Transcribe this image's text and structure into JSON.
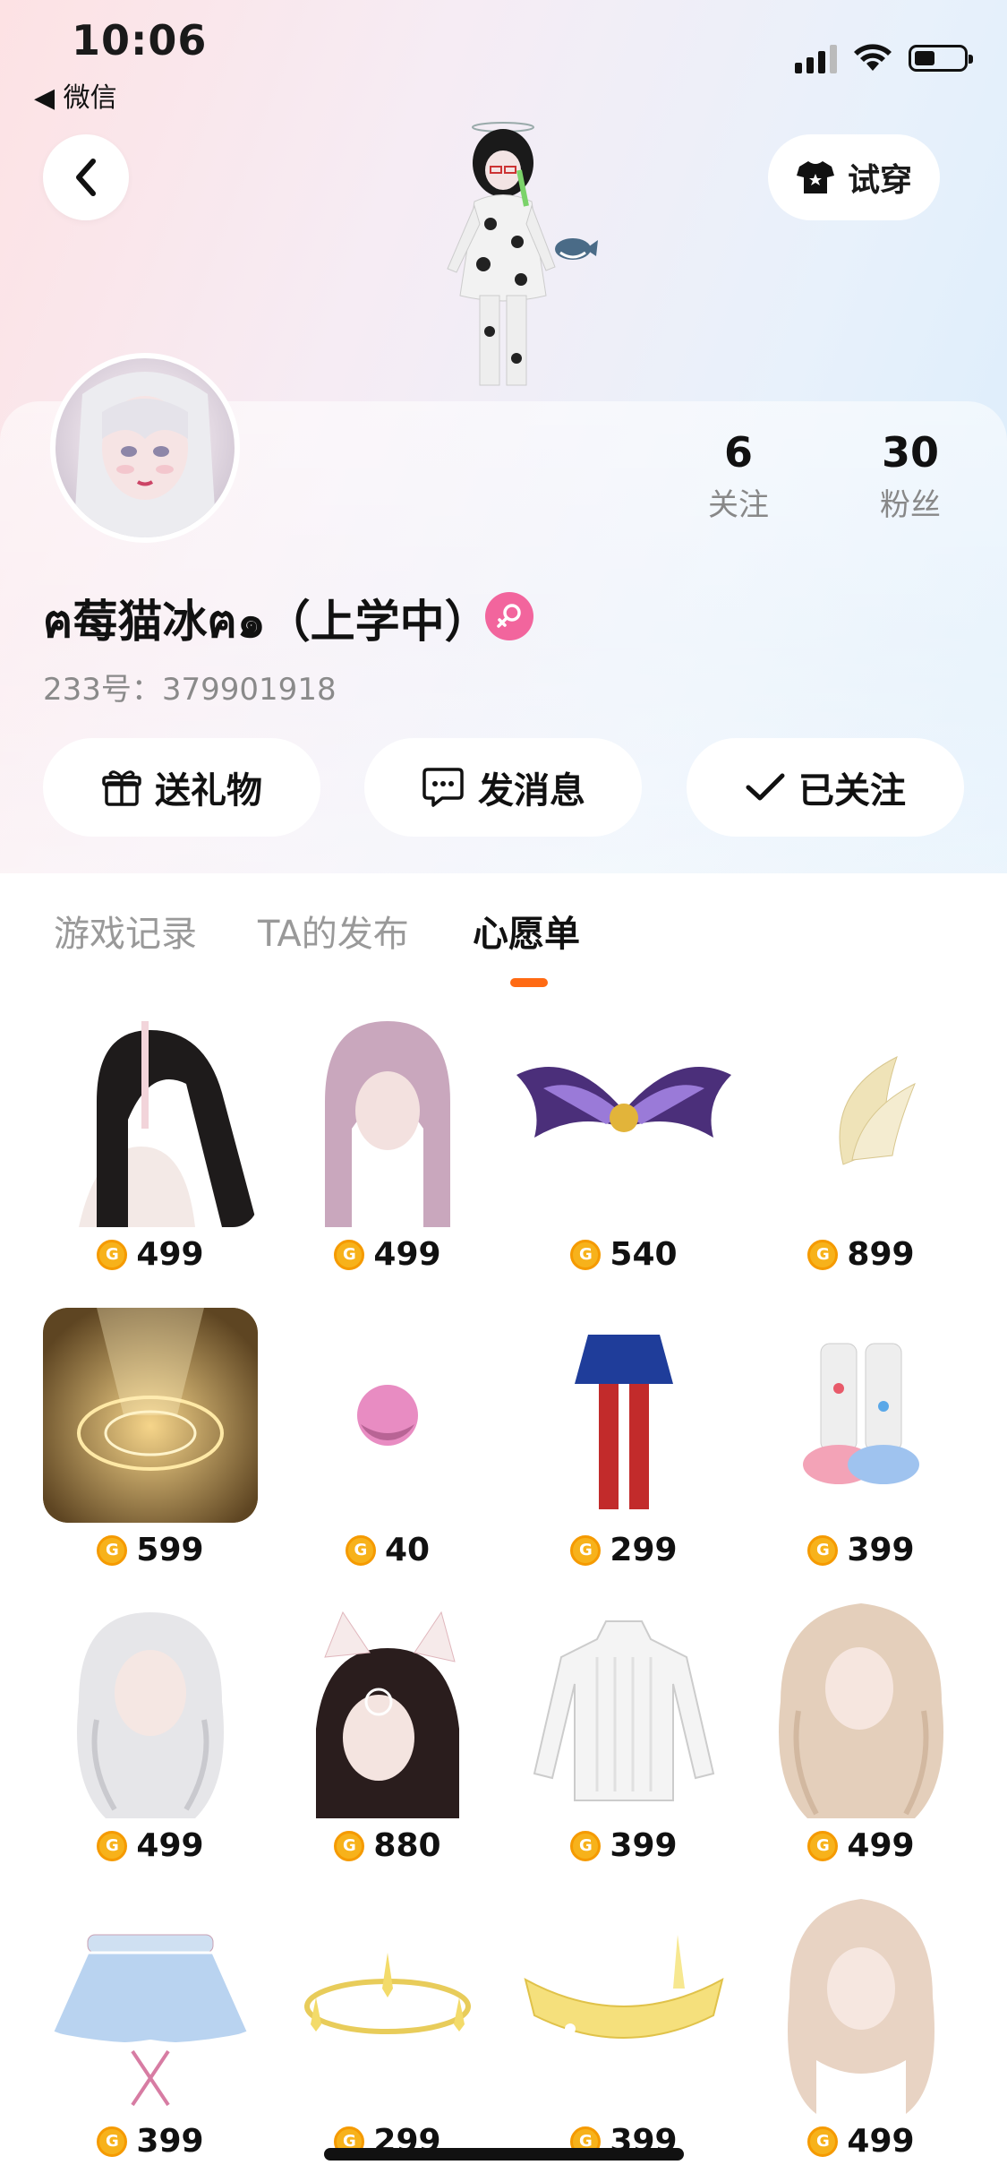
{
  "status_bar": {
    "time": "10:06",
    "back_app": "◀ 微信"
  },
  "header": {
    "tryon_label": "试穿"
  },
  "profile": {
    "name": "ฅ莓猫冰ฅ๑（上学中）",
    "id_text": "233号：379901918",
    "following_count": "6",
    "following_label": "关注",
    "followers_count": "30",
    "followers_label": "粉丝",
    "gender_color": "#f2659d"
  },
  "actions": {
    "gift_label": "送礼物",
    "message_label": "发消息",
    "followed_label": "已关注"
  },
  "tabs": [
    {
      "label": "游戏记录",
      "active": false
    },
    {
      "label": "TA的发布",
      "active": false
    },
    {
      "label": "心愿单",
      "active": true
    }
  ],
  "accent_color": "#ff6a13",
  "wishlist": [
    {
      "name": "black-ponytail-hair",
      "price": "499"
    },
    {
      "name": "pink-long-hair",
      "price": "499"
    },
    {
      "name": "purple-wings",
      "price": "540"
    },
    {
      "name": "feather-hair-clip",
      "price": "899"
    },
    {
      "name": "golden-magic-circle",
      "price": "599"
    },
    {
      "name": "pink-ball",
      "price": "40"
    },
    {
      "name": "skirt-red-stockings",
      "price": "299"
    },
    {
      "name": "pastel-boots",
      "price": "399"
    },
    {
      "name": "silver-wavy-hair",
      "price": "499"
    },
    {
      "name": "cat-ear-hair",
      "price": "880"
    },
    {
      "name": "white-knit-dress",
      "price": "399"
    },
    {
      "name": "blonde-wavy-hair",
      "price": "499"
    },
    {
      "name": "blue-tutu-skirt",
      "price": "399"
    },
    {
      "name": "golden-halo",
      "price": "299"
    },
    {
      "name": "golden-crown-band",
      "price": "399"
    },
    {
      "name": "cream-long-hair",
      "price": "499"
    }
  ]
}
